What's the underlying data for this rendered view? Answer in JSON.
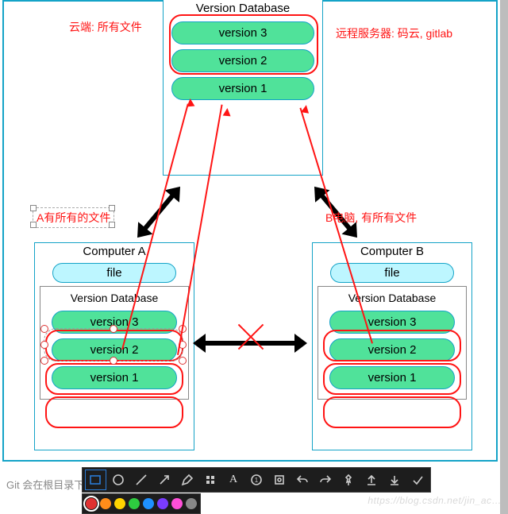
{
  "server": {
    "title": "Version Database",
    "versions": [
      "version 3",
      "version 2",
      "version 1"
    ]
  },
  "compA": {
    "title": "Computer  A",
    "file": "file",
    "db_title": "Version Database",
    "versions": [
      "version 3",
      "version 2",
      "version 1"
    ]
  },
  "compB": {
    "title": "Computer  B",
    "file": "file",
    "db_title": "Version Database",
    "versions": [
      "version 3",
      "version 2",
      "version 1"
    ]
  },
  "annot": {
    "cloud": "云端: 所有文件",
    "remote": "远程服务器: 码云, gitlab",
    "a_has": "A有所有的文件",
    "b_has": "B电脑, 有所有文件"
  },
  "caption": "Git 会在根目录下创建一个 .git 隐藏文件夹，作为本地代码仓库",
  "watermark": "https://blog.csdn.net/jin_ac…",
  "palette": [
    "#e03131",
    "#ff8c1a",
    "#ffd400",
    "#2ecc40",
    "#1e90ff",
    "#7a3cff",
    "#ff4fd8",
    "#888888",
    "#ffffff",
    "#000000"
  ],
  "palette_selected": 0,
  "toolbar_selected": 0
}
